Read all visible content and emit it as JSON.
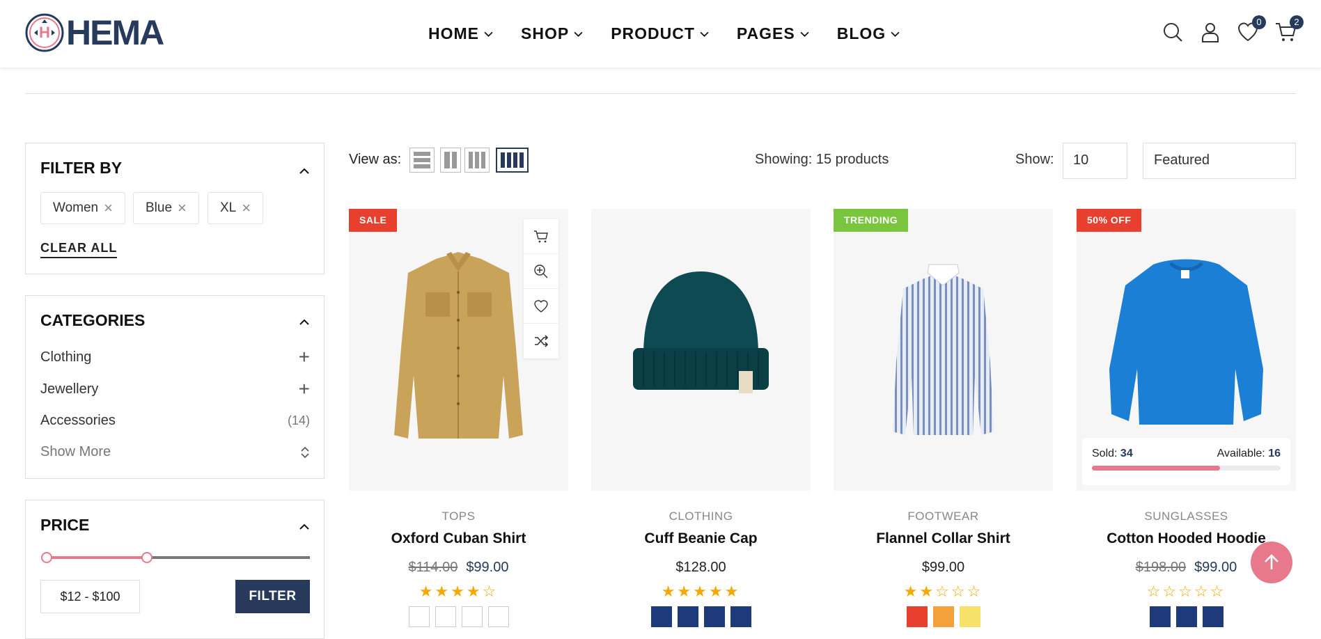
{
  "header": {
    "logo_text": "HEMA",
    "nav": [
      {
        "label": "HOME"
      },
      {
        "label": "SHOP"
      },
      {
        "label": "PRODUCT"
      },
      {
        "label": "PAGES"
      },
      {
        "label": "BLOG"
      }
    ],
    "wishlist_count": "0",
    "cart_count": "2"
  },
  "filter": {
    "title": "FILTER BY",
    "chips": [
      "Women",
      "Blue",
      "XL"
    ],
    "clear_all": "CLEAR ALL"
  },
  "categories": {
    "title": "CATEGORIES",
    "items": [
      {
        "label": "Clothing",
        "extra": "+"
      },
      {
        "label": "Jewellery",
        "extra": "+"
      },
      {
        "label": "Accessories",
        "extra": "(14)"
      }
    ],
    "show_more": "Show More"
  },
  "price": {
    "title": "PRICE",
    "range": "$12 - $100",
    "filter_label": "FILTER",
    "slider_min_fraction": 0.0,
    "slider_max_fraction": 0.38
  },
  "toolbar": {
    "view_as": "View as:",
    "showing": "Showing: 15 products",
    "show_label": "Show:",
    "show_value": "10",
    "sort_value": "Featured",
    "active_view": 4
  },
  "products": [
    {
      "tag": "SALE",
      "tag_color": "#e8402f",
      "category": "TOPS",
      "name": "Oxford Cuban Shirt",
      "old_price": "$114.00",
      "price": "$99.00",
      "rating": 4,
      "stars": "★★★★☆"
    },
    {
      "tag": "",
      "category": "CLOTHING",
      "name": "Cuff Beanie Cap",
      "old_price": "",
      "price": "$128.00",
      "rating": 5,
      "stars": "★★★★★"
    },
    {
      "tag": "TRENDING",
      "tag_color": "#7ac53e",
      "category": "FOOTWEAR",
      "name": "Flannel Collar Shirt",
      "old_price": "",
      "price": "$99.00",
      "rating": 2,
      "stars": "★★☆☆☆"
    },
    {
      "tag": "50% OFF",
      "tag_color": "#e8402f",
      "category": "SUNGLASSES",
      "name": "Cotton Hooded Hoodie",
      "old_price": "$198.00",
      "price": "$99.00",
      "rating": 0,
      "stars": "☆☆☆☆☆",
      "sold_label": "Sold:",
      "sold": "34",
      "available_label": "Available:",
      "available": "16",
      "sold_fraction": 0.68
    }
  ],
  "colors": {
    "brand": "#273a5c",
    "accent": "#e8788c",
    "star": "#f6a800"
  }
}
